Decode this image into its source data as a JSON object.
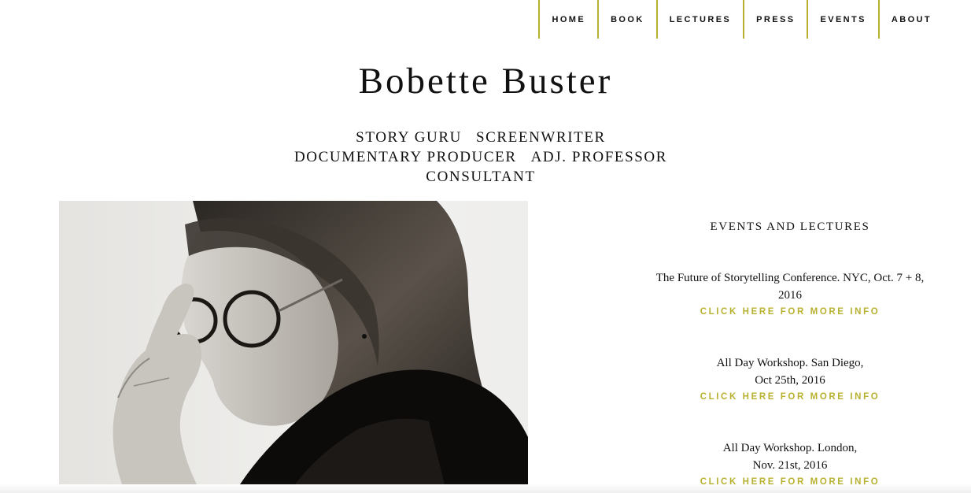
{
  "nav": {
    "items": [
      {
        "label": "HOME"
      },
      {
        "label": "BOOK"
      },
      {
        "label": "LECTURES"
      },
      {
        "label": "PRESS"
      },
      {
        "label": "EVENTS"
      },
      {
        "label": "ABOUT"
      }
    ]
  },
  "header": {
    "title": "Bobette Buster",
    "tagline": {
      "line1a": "STORY GURU",
      "line1b": "SCREENWRITER",
      "line2a": "DOCUMENTARY PRODUCER",
      "line2b": "ADJ. PROFESSOR",
      "line3": "CONSULTANT"
    }
  },
  "events": {
    "heading": "EVENTS AND LECTURES",
    "items": [
      {
        "line1": "The Future of Storytelling Conference. NYC, Oct. 7 + 8,",
        "line2": "2016",
        "link": "CLICK HERE FOR MORE INFO"
      },
      {
        "line1": "All Day Workshop. San Diego,",
        "line2": "Oct 25th, 2016",
        "link": "CLICK HERE FOR MORE INFO"
      },
      {
        "line1": "All Day Workshop. London,",
        "line2": "Nov. 21st, 2016",
        "link": "CLICK HERE FOR MORE INFO"
      }
    ]
  },
  "colors": {
    "accent": "#b8b130",
    "text": "#111111",
    "background": "#ffffff"
  }
}
